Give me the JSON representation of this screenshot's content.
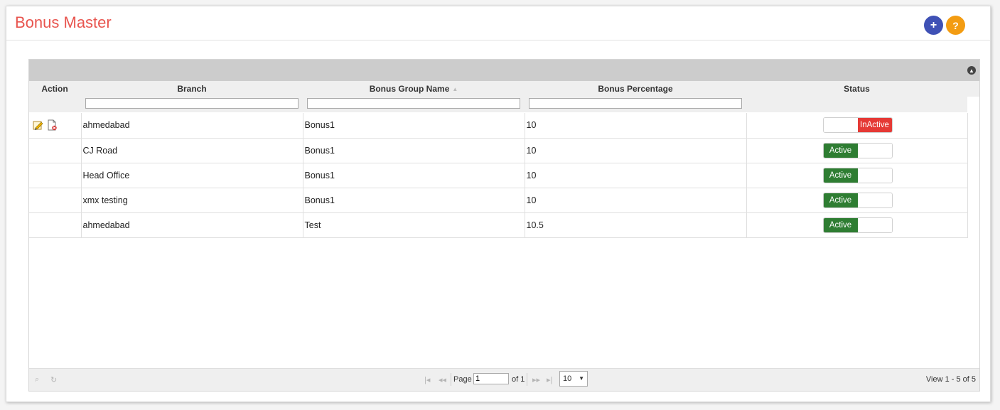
{
  "page": {
    "title": "Bonus Master",
    "add_button": "+",
    "help_button": "?"
  },
  "grid": {
    "columns": {
      "action": "Action",
      "branch": "Branch",
      "bonus_group_name": "Bonus Group Name",
      "bonus_percentage": "Bonus Percentage",
      "status": "Status"
    },
    "filters": {
      "branch": "",
      "bonus_group_name": "",
      "bonus_percentage": ""
    },
    "rows": [
      {
        "branch": "ahmedabad",
        "group": "Bonus1",
        "percentage": "10",
        "status": "InActive"
      },
      {
        "branch": "CJ Road",
        "group": "Bonus1",
        "percentage": "10",
        "status": "Active"
      },
      {
        "branch": "Head Office",
        "group": "Bonus1",
        "percentage": "10",
        "status": "Active"
      },
      {
        "branch": "xmx testing",
        "group": "Bonus1",
        "percentage": "10",
        "status": "Active"
      },
      {
        "branch": "ahmedabad",
        "group": "Test",
        "percentage": "10.5",
        "status": "Active"
      }
    ]
  },
  "pager": {
    "page_label": "Page",
    "page_value": "1",
    "of_label": "of 1",
    "rows_per_page": "10",
    "view_info": "View 1 - 5 of 5"
  },
  "colors": {
    "title": "#e8544e",
    "add": "#3f51b5",
    "help": "#f39c12",
    "active": "#2e7d32",
    "inactive": "#e53935"
  },
  "icons": [
    "plus-icon",
    "question-icon",
    "collapse-icon",
    "edit-icon",
    "delete-icon",
    "search-icon",
    "refresh-icon",
    "first-page-icon",
    "prev-page-icon",
    "next-page-icon",
    "last-page-icon",
    "caret-down-icon"
  ]
}
